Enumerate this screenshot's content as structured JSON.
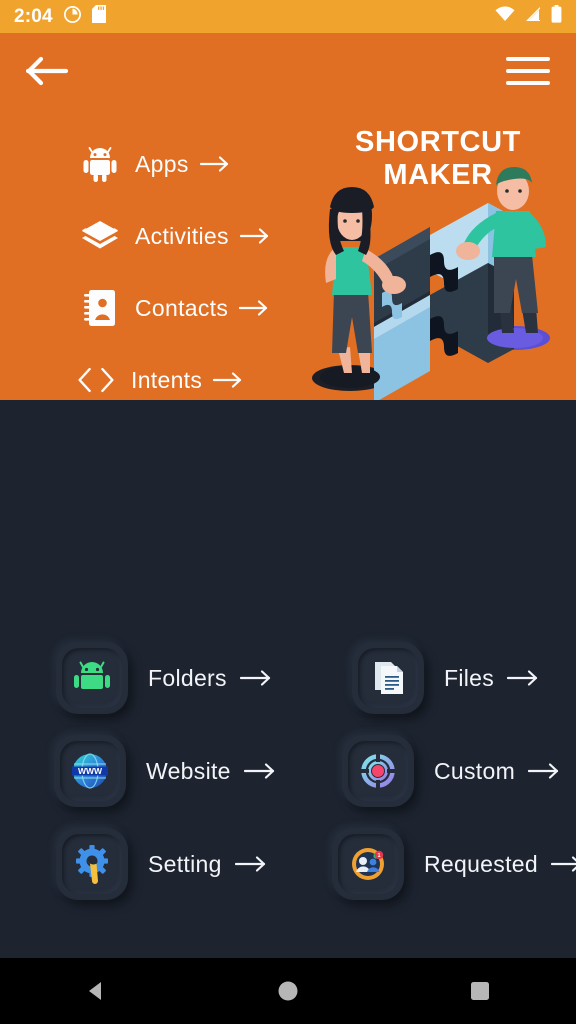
{
  "status_bar": {
    "time": "2:04",
    "left_icons": [
      "clock-icon",
      "sd-card-icon"
    ],
    "right_icons": [
      "wifi-icon",
      "signal-icon",
      "battery-icon"
    ],
    "background_color": "#f0a42e"
  },
  "header": {
    "background_color": "#e06f24",
    "back_icon": "back-arrow-icon",
    "menu_icon": "hamburger-menu-icon",
    "app_title": "SHORTCUT MAKER",
    "hero_illustration": "puzzle-teamwork-illustration",
    "nav_items": [
      {
        "label": "Apps",
        "icon": "android-robot-icon",
        "arrow": "arrow-right-icon"
      },
      {
        "label": "Activities",
        "icon": "layers-icon",
        "arrow": "arrow-right-icon"
      },
      {
        "label": "Contacts",
        "icon": "contact-book-icon",
        "arrow": "arrow-right-icon"
      },
      {
        "label": "Intents",
        "icon": "code-brackets-icon",
        "arrow": "arrow-right-icon"
      }
    ]
  },
  "main": {
    "background_color": "#1d2430",
    "tile_color": "#252d3b",
    "shortcuts": [
      {
        "label": "Folders",
        "icon": "android-folder-icon",
        "arrow": "arrow-right-icon"
      },
      {
        "label": "Files",
        "icon": "documents-icon",
        "arrow": "arrow-right-icon"
      },
      {
        "label": "Website",
        "icon": "www-globe-icon",
        "arrow": "arrow-right-icon"
      },
      {
        "label": "Custom",
        "icon": "target-icon",
        "arrow": "arrow-right-icon"
      },
      {
        "label": "Setting",
        "icon": "gear-wrench-icon",
        "arrow": "arrow-right-icon"
      },
      {
        "label": "Requested",
        "icon": "contacts-badge-icon",
        "arrow": "arrow-right-icon"
      }
    ]
  },
  "system_nav": {
    "background_color": "#000000",
    "buttons": [
      {
        "name": "back",
        "icon": "triangle-back-icon"
      },
      {
        "name": "home",
        "icon": "circle-home-icon"
      },
      {
        "name": "recents",
        "icon": "square-recents-icon"
      }
    ]
  }
}
